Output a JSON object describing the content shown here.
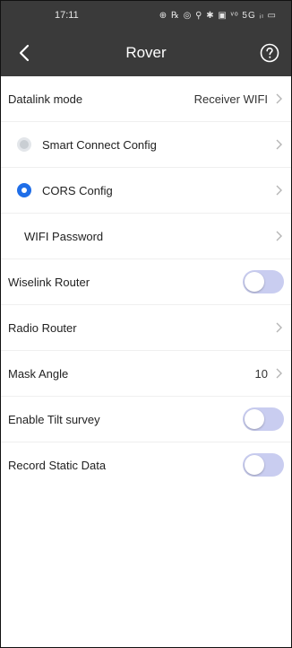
{
  "status_bar": {
    "time": "17:11",
    "icons": "⊕ ℞ ◎ ⚲ ✱ ▣ ᵛᵒ 5G ᵢₗ ▭"
  },
  "nav": {
    "title": "Rover"
  },
  "settings": {
    "datalink_mode": {
      "label": "Datalink mode",
      "value": "Receiver WIFI"
    },
    "smart_connect": {
      "label": "Smart Connect Config",
      "selected": false
    },
    "cors_config": {
      "label": "CORS Config",
      "selected": true
    },
    "wifi_password": {
      "label": "WIFI Password"
    },
    "wiselink_router": {
      "label": "Wiselink Router",
      "enabled": false
    },
    "radio_router": {
      "label": "Radio Router"
    },
    "mask_angle": {
      "label": "Mask Angle",
      "value": "10"
    },
    "enable_tilt": {
      "label": "Enable Tilt survey",
      "enabled": false
    },
    "record_static": {
      "label": "Record Static Data",
      "enabled": false
    }
  },
  "colors": {
    "topbar": "#3a3a3a",
    "accent": "#1f6ee8",
    "toggle_off": "#c9cdf0"
  }
}
